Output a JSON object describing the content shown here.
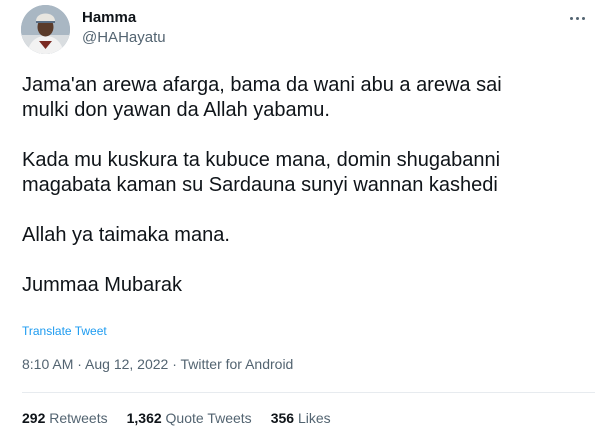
{
  "author": {
    "display_name": "Hamma",
    "handle": "@HAHayatu"
  },
  "tweet": {
    "paragraphs": [
      "Jama'an arewa afarga, bama da wani abu a arewa sai\nmulki don yawan da Allah yabamu.",
      "Kada mu kuskura ta kubuce mana, domin shugabanni\nmagabata kaman su Sardauna sunyi wannan kashedi",
      "Allah ya taimaka mana.",
      "Jummaa Mubarak"
    ],
    "translate_label": "Translate Tweet",
    "timestamp": "8:10 AM · Aug 12, 2022 · Twitter for Android"
  },
  "stats": {
    "retweets_count": "292",
    "retweets_label": "Retweets",
    "quotes_count": "1,362",
    "quotes_label": "Quote Tweets",
    "likes_count": "356",
    "likes_label": "Likes"
  },
  "colors": {
    "text": "#0f1419",
    "secondary": "#536471",
    "link": "#1d9bf0",
    "divider": "#e7ebef"
  },
  "icons": {
    "more": "more-horizontal-icon"
  }
}
